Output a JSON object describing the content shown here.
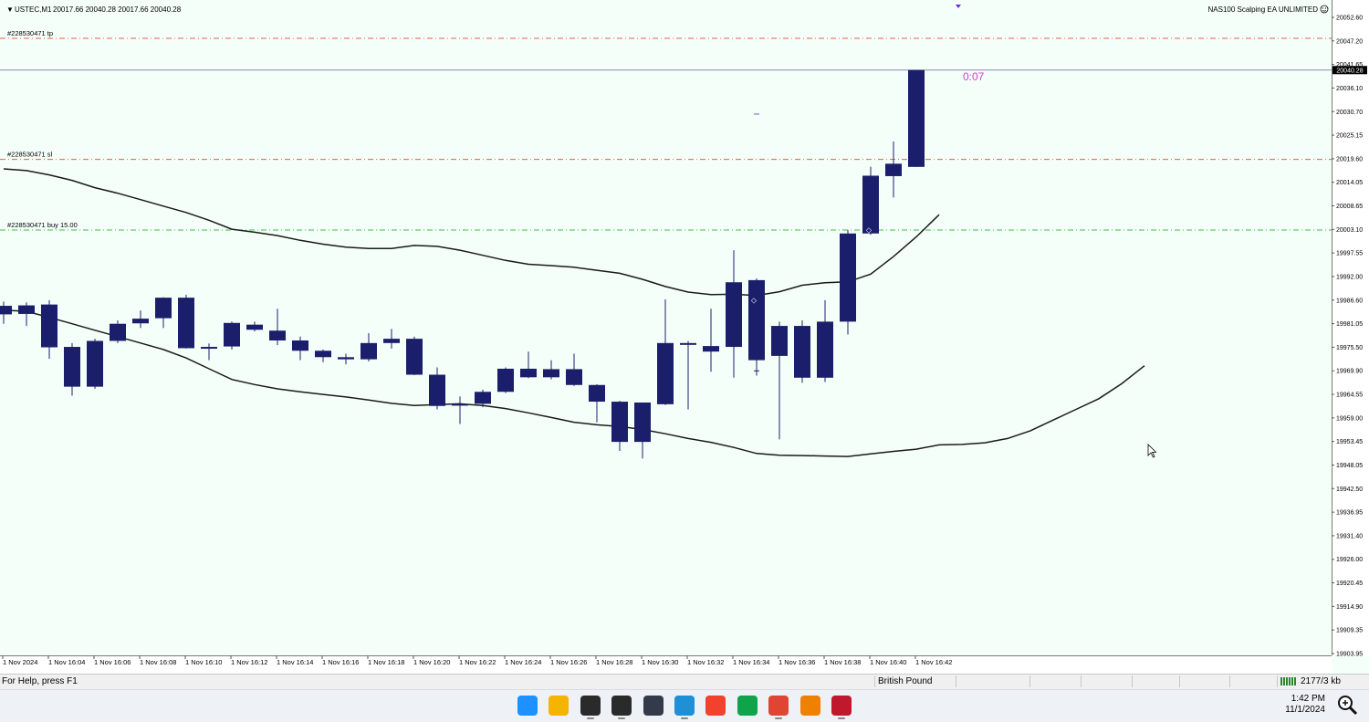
{
  "chart_header": {
    "symbol": "USTEC,M1",
    "ohlc": "20017.66 20040.28 20017.66 20040.28",
    "ea_name": "NAS100 Scalping EA UNLIMITED",
    "smiley_icon": "smiley-icon"
  },
  "order_labels": {
    "tp": "#228530471 tp",
    "sl": "#228530471 sl",
    "buy": "#228530471 buy 15.00"
  },
  "timer_text": "0:07",
  "colors": {
    "background": "#f5fff9",
    "candle": "#1b1f6b",
    "tp_line": "#e0604a",
    "sl_line": "#e0604a",
    "buy_line": "#48b84a",
    "bid_line": "#8c8cb4",
    "band": "#1a1a1a",
    "timer": "#d43cd4"
  },
  "chart_data": {
    "type": "candlestick",
    "symbol": "USTEC",
    "timeframe": "M1",
    "y_ticks": [
      "20052.60",
      "20047.20",
      "20041.65",
      "20036.10",
      "20030.70",
      "20025.15",
      "20019.60",
      "20014.05",
      "20008.65",
      "20003.10",
      "19997.55",
      "19992.00",
      "19986.60",
      "19981.05",
      "19975.50",
      "19969.90",
      "19964.55",
      "19959.00",
      "19953.45",
      "19948.05",
      "19942.50",
      "19936.95",
      "19931.40",
      "19926.00",
      "19920.45",
      "19914.90",
      "19909.35",
      "19903.95"
    ],
    "current_price": "20040.28",
    "x_labels": [
      "1 Nov 2024",
      "1 Nov 16:04",
      "1 Nov 16:06",
      "1 Nov 16:08",
      "1 Nov 16:10",
      "1 Nov 16:12",
      "1 Nov 16:14",
      "1 Nov 16:16",
      "1 Nov 16:18",
      "1 Nov 16:20",
      "1 Nov 16:22",
      "1 Nov 16:24",
      "1 Nov 16:26",
      "1 Nov 16:28",
      "1 Nov 16:30",
      "1 Nov 16:32",
      "1 Nov 16:34",
      "1 Nov 16:36",
      "1 Nov 16:38",
      "1 Nov 16:40",
      "1 Nov 16:42"
    ],
    "levels": {
      "tp": 20047.7,
      "sl": 20019.4,
      "buy": 20002.9,
      "bid": 20040.28
    },
    "candles": [
      [
        19985.2,
        19986.2,
        19981.0,
        19983.2
      ],
      [
        19983.3,
        19986.0,
        19980.5,
        19985.3
      ],
      [
        19985.5,
        19986.5,
        19972.8,
        19975.5
      ],
      [
        19975.6,
        19976.5,
        19964.2,
        19966.3
      ],
      [
        19966.3,
        19977.5,
        19965.8,
        19977.0
      ],
      [
        19977.0,
        19981.8,
        19976.5,
        19981.0
      ],
      [
        19981.1,
        19984.1,
        19980.0,
        19982.2
      ],
      [
        19982.3,
        19987.2,
        19980.0,
        19987.1
      ],
      [
        19987.1,
        19987.8,
        19975.2,
        19975.3
      ],
      [
        19975.5,
        19976.4,
        19972.5,
        19975.6
      ],
      [
        19975.7,
        19981.5,
        19975.0,
        19981.2
      ],
      [
        19980.8,
        19981.5,
        19979.2,
        19979.6
      ],
      [
        19979.4,
        19984.5,
        19976.0,
        19977.1
      ],
      [
        19977.1,
        19978.0,
        19972.5,
        19974.7
      ],
      [
        19974.7,
        19975.0,
        19972.0,
        19973.2
      ],
      [
        19973.2,
        19974.0,
        19971.5,
        19972.7
      ],
      [
        19972.7,
        19978.8,
        19972.2,
        19976.5
      ],
      [
        19976.5,
        19979.8,
        19975.2,
        19977.5
      ],
      [
        19977.5,
        19978.0,
        19969.0,
        19969.1
      ],
      [
        19969.1,
        19970.8,
        19961.0,
        19961.8
      ],
      [
        19962.0,
        19964.0,
        19957.6,
        19962.3
      ],
      [
        19962.3,
        19965.6,
        19961.5,
        19965.1
      ],
      [
        19965.1,
        19970.8,
        19964.8,
        19970.5
      ],
      [
        19970.5,
        19974.5,
        19968.3,
        19968.5
      ],
      [
        19968.5,
        19972.5,
        19968.0,
        19970.4
      ],
      [
        19970.4,
        19974.0,
        19966.5,
        19966.7
      ],
      [
        19966.7,
        19966.9,
        19958.0,
        19962.8
      ],
      [
        19962.8,
        19963.0,
        19951.3,
        19953.4
      ],
      [
        19953.4,
        19962.5,
        19949.5,
        19962.6
      ],
      [
        19962.2,
        19986.7,
        19962.0,
        19976.5
      ],
      [
        19976.5,
        19977.0,
        19961.0,
        19976.3
      ],
      [
        19974.5,
        19984.5,
        19969.8,
        19975.8
      ],
      [
        19975.6,
        19998.2,
        19968.4,
        19990.7
      ],
      [
        19991.2,
        19991.6,
        19968.9,
        19972.5
      ],
      [
        19973.5,
        19981.5,
        19954.0,
        19980.5
      ],
      [
        19980.5,
        19981.8,
        19967.2,
        19968.4
      ],
      [
        19968.4,
        19986.5,
        19967.4,
        19981.5
      ],
      [
        19981.5,
        20002.9,
        19978.5,
        20002.1
      ],
      [
        20002.1,
        20017.7,
        20001.8,
        20015.6
      ],
      [
        20015.5,
        20023.6,
        20010.5,
        20018.4
      ],
      [
        20017.66,
        20040.28,
        20017.66,
        20040.28
      ]
    ],
    "upper_band": [
      20017.2,
      20016.8,
      20015.8,
      20014.5,
      20012.8,
      20011.5,
      20010.0,
      20008.5,
      20007.0,
      20005.2,
      20003.1,
      20002.4,
      20001.6,
      20000.5,
      19999.6,
      19998.9,
      19998.6,
      19998.6,
      19999.3,
      19999.1,
      19998.2,
      19997.0,
      19995.8,
      19994.9,
      19994.6,
      19994.2,
      19993.5,
      19992.8,
      19991.4,
      19989.7,
      19988.4,
      19987.8,
      19987.9,
      19987.6,
      19988.5,
      19990.0,
      19990.6,
      19990.8,
      19992.6,
      19996.7,
      20001.3,
      20006.5
    ],
    "lower_band": [
      19984.2,
      19983.9,
      19982.5,
      19981.0,
      19979.5,
      19978.0,
      19976.5,
      19975.0,
      19973.0,
      19970.5,
      19968.0,
      19966.8,
      19965.8,
      19965.1,
      19964.5,
      19963.9,
      19963.2,
      19962.4,
      19961.9,
      19962.1,
      19962.3,
      19961.9,
      19961.2,
      19960.2,
      19959.1,
      19958.0,
      19957.4,
      19957.0,
      19956.3,
      19955.3,
      19954.2,
      19953.3,
      19952.1,
      19950.7,
      19950.3,
      19950.2,
      19950.1,
      19950.0,
      19950.6,
      19951.2,
      19951.7,
      19952.7,
      19952.8,
      19953.2,
      19954.2,
      19956.0,
      19958.5,
      19961.0,
      19963.5,
      19967.0,
      19971.2
    ],
    "grid": false,
    "legend": "none"
  },
  "status_bar": {
    "help": "For Help, press F1",
    "profile": "British Pound",
    "connection": "2177/3 kb"
  },
  "taskbar": {
    "time": "1:42 PM",
    "date": "11/1/2024",
    "apps": [
      {
        "name": "start-icon",
        "color": "#1e90ff",
        "active": false
      },
      {
        "name": "file-explorer-icon",
        "color": "#f4b400",
        "active": false
      },
      {
        "name": "metatrader-icon",
        "color": "#2a2a2a",
        "active": true
      },
      {
        "name": "metatrader2-icon",
        "color": "#2a2a2a",
        "active": true
      },
      {
        "name": "owl-app-icon",
        "color": "#333a4a",
        "active": false
      },
      {
        "name": "edge-icon",
        "color": "#1f8fd6",
        "active": true
      },
      {
        "name": "media-app-icon",
        "color": "#f2412c",
        "active": false
      },
      {
        "name": "trading-app-icon",
        "color": "#0fa34a",
        "active": false
      },
      {
        "name": "chrome-icon",
        "color": "#e04433",
        "active": true
      },
      {
        "name": "vlc-icon",
        "color": "#f08000",
        "active": false
      },
      {
        "name": "recorder-icon",
        "color": "#c0182c",
        "active": true
      }
    ]
  }
}
